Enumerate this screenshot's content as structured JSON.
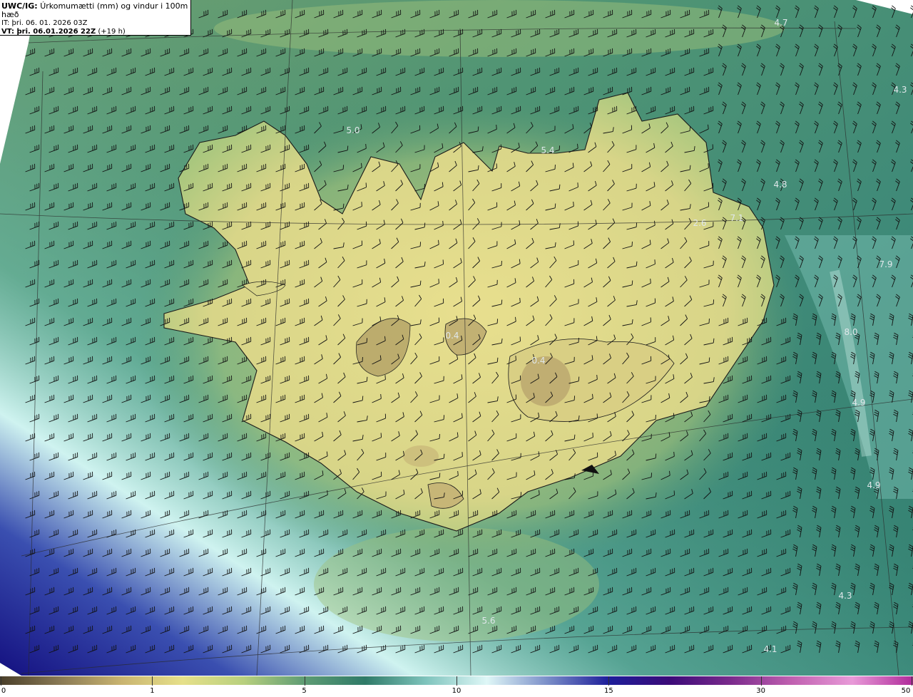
{
  "header": {
    "model": "UWC/IG:",
    "title": "Úrkomumætti (mm) og vindur i 100m hæð",
    "issue_time": "IT: þri. 06. 01. 2026 03Z",
    "valid_time": "VT: þri. 06.01.2026 22Z",
    "lead_time": "(+19 h)"
  },
  "map_labels": [
    {
      "text": "4.7"
    },
    {
      "text": "4.3"
    },
    {
      "text": "5.0"
    },
    {
      "text": "5.4"
    },
    {
      "text": "4.8"
    },
    {
      "text": "2.6"
    },
    {
      "text": "7.1"
    },
    {
      "text": "7.9"
    },
    {
      "text": "8.0"
    },
    {
      "text": "4.9"
    },
    {
      "text": "4.9"
    },
    {
      "text": "4.3"
    },
    {
      "text": "5.6"
    },
    {
      "text": "4.1"
    },
    {
      "text": "0.4"
    },
    {
      "text": "0.4"
    }
  ],
  "colorbar": {
    "ticks": [
      {
        "value": "0",
        "frac": 0.0
      },
      {
        "value": "1",
        "frac": 0.1667
      },
      {
        "value": "5",
        "frac": 0.3333
      },
      {
        "value": "10",
        "frac": 0.5
      },
      {
        "value": "15",
        "frac": 0.6667
      },
      {
        "value": "30",
        "frac": 0.8333
      },
      {
        "value": "50",
        "frac": 1.0
      }
    ],
    "colors": [
      "#4a3f2a",
      "#8a7a55",
      "#c9b470",
      "#e6e08a",
      "#b8d07e",
      "#5e9c74",
      "#2f7a68",
      "#7fc4bd",
      "#dff7f7",
      "#7a8ec8",
      "#1e1e9a",
      "#3b0a78",
      "#7a2a8c",
      "#c060b0",
      "#e89ad8",
      "#b02a9a"
    ]
  },
  "colors": {
    "sea": "#3f8f7a",
    "land": "#e0d98a",
    "highland": "#b8a86a",
    "coast": "#1a1a1a"
  }
}
